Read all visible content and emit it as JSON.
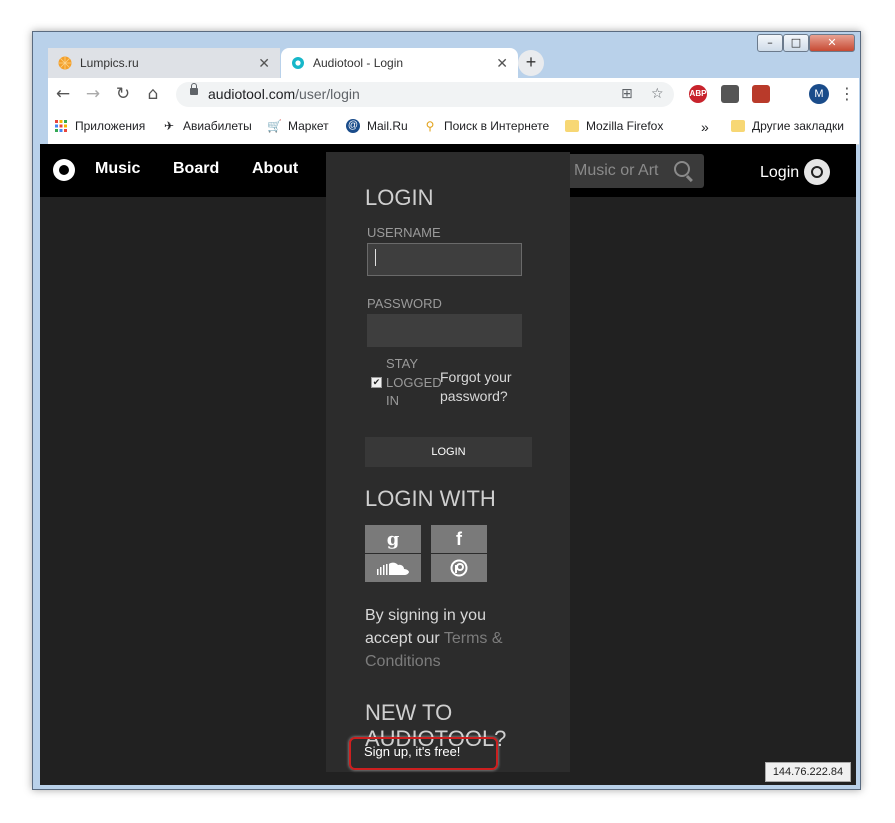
{
  "window_controls": {
    "minimize": "–",
    "maximize": "□",
    "close": "✕"
  },
  "tabs": [
    {
      "title": "Lumpics.ru",
      "close": "✕",
      "active": false
    },
    {
      "title": "Audiotool - Login",
      "close": "✕",
      "active": true
    }
  ],
  "new_tab": "+",
  "toolbar": {
    "back": "←",
    "forward": "→",
    "reload": "↻",
    "home": "⌂",
    "url_host": "audiotool.com",
    "url_path": "/user/login",
    "translate_icon": "⊞",
    "star": "☆",
    "abp": "ABP",
    "profile_initial": "M",
    "menu": "⋮"
  },
  "bookmarks": {
    "items": [
      {
        "label": "Приложения",
        "icon": "apps-grid-icon"
      },
      {
        "label": "Авиабилеты",
        "icon": "plane-icon"
      },
      {
        "label": "Маркет",
        "icon": "cart-icon"
      },
      {
        "label": "Mail.Ru",
        "icon": "mailru-icon"
      },
      {
        "label": "Поиск в Интернете",
        "icon": "search-icon"
      },
      {
        "label": "Mozilla Firefox",
        "icon": "folder-icon"
      }
    ],
    "overflow": "»",
    "other": "Другие закладки"
  },
  "site": {
    "nav": [
      "Music",
      "Board",
      "About"
    ],
    "search_placeholder": "Music or Art",
    "login_link": "Login"
  },
  "login": {
    "heading": "LOGIN",
    "username_label": "USERNAME",
    "password_label": "PASSWORD",
    "stay_logged_in": "STAY LOGGED IN",
    "stay_checked": true,
    "forgot": "Forgot your password?",
    "button": "LOGIN",
    "login_with": "LOGIN WITH",
    "social": [
      {
        "glyph": "g",
        "icon": "google-icon"
      },
      {
        "glyph": "f",
        "icon": "facebook-icon"
      },
      {
        "glyph": "",
        "icon": "soundcloud-icon"
      },
      {
        "glyph": "",
        "icon": "patreon-icon"
      }
    ],
    "terms_prefix": "By signing in you accept our",
    "terms_link": "Terms & Conditions",
    "new_heading": "NEW TO AUDIOTOOL?",
    "signup": "Sign up, it's free!"
  },
  "status_ip": "144.76.222.84",
  "colors": {
    "highlight": "#cc1f1f",
    "site_bg": "#212121",
    "panel_bg": "#2c2c2c"
  }
}
